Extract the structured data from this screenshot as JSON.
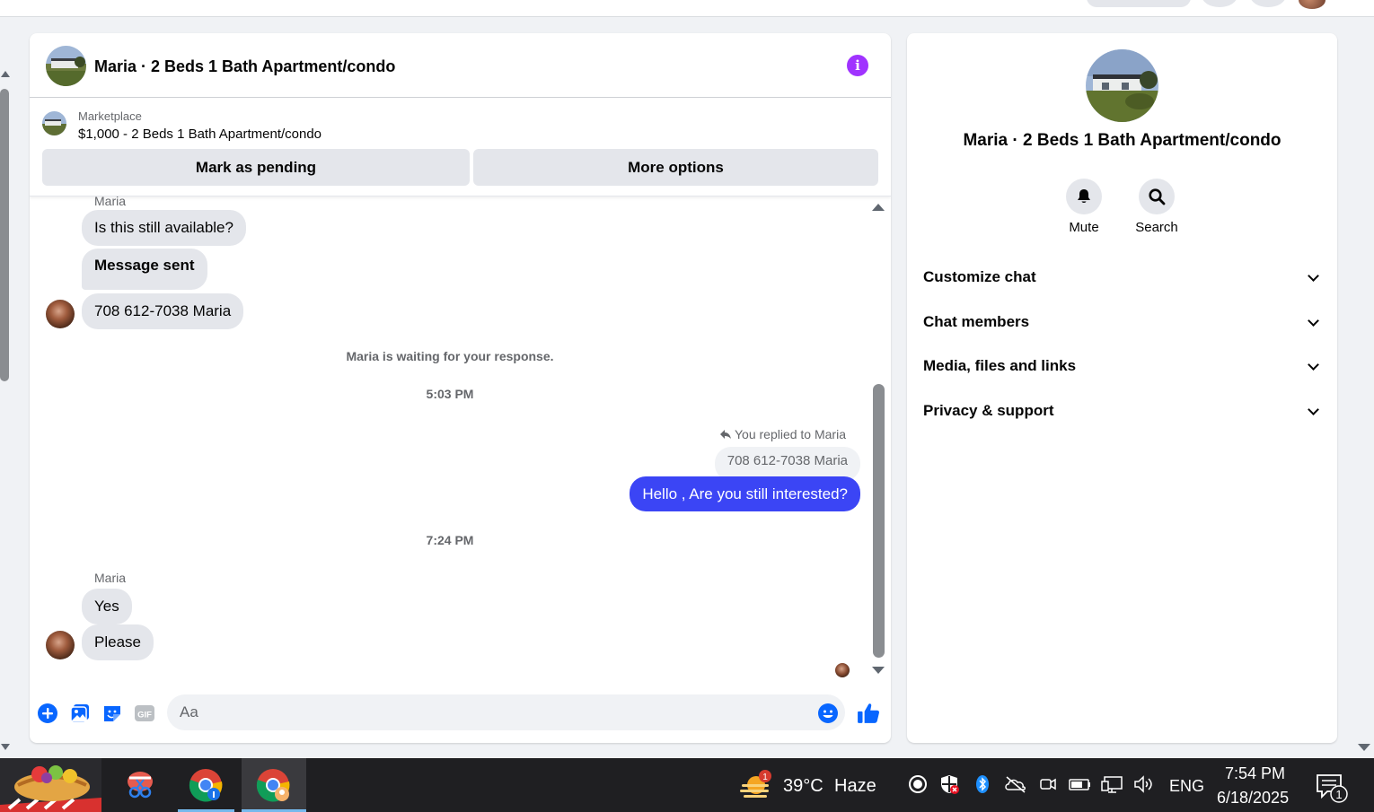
{
  "conversation": {
    "title": "Maria · 2 Beds 1 Bath Apartment/condo",
    "info_icon": "info-icon"
  },
  "marketplace": {
    "label": "Marketplace",
    "listing": "$1,000 - 2 Beds 1 Bath Apartment/condo",
    "mark_pending_label": "Mark as pending",
    "more_options_label": "More options"
  },
  "messages": {
    "sender1": "Maria",
    "m1": "Is this still available?",
    "m2": "Message sent",
    "m3": "708 612-7038 Maria",
    "waiting": "Maria is waiting for your response.",
    "time1": "5:03 PM",
    "replied_to": "You replied to Maria",
    "quoted": "708 612-7038 Maria",
    "outgoing": "Hello , Are you still interested?",
    "time2": "7:24 PM",
    "sender2": "Maria",
    "m4": "Yes",
    "m5": "Please"
  },
  "composer": {
    "placeholder": "Aa",
    "value": "",
    "icons": [
      "plus-icon",
      "photo-icon",
      "sticker-icon",
      "gif-icon",
      "emoji-icon",
      "like-icon"
    ]
  },
  "panel": {
    "title": "Maria · 2 Beds 1 Bath Apartment/condo",
    "mute_label": "Mute",
    "search_label": "Search",
    "sections": [
      "Customize chat",
      "Chat members",
      "Media, files and links",
      "Privacy & support"
    ]
  },
  "taskbar": {
    "weather_badge": "1",
    "weather_temp": "39°C",
    "weather_desc": "Haze",
    "language": "ENG",
    "time": "7:54 PM",
    "date": "6/18/2025",
    "notification_count": "1"
  },
  "colors": {
    "accent": "#3b45f5",
    "info": "#a033ff",
    "messenger_blue": "#0866ff",
    "bubble_gray": "#e4e6eb"
  }
}
